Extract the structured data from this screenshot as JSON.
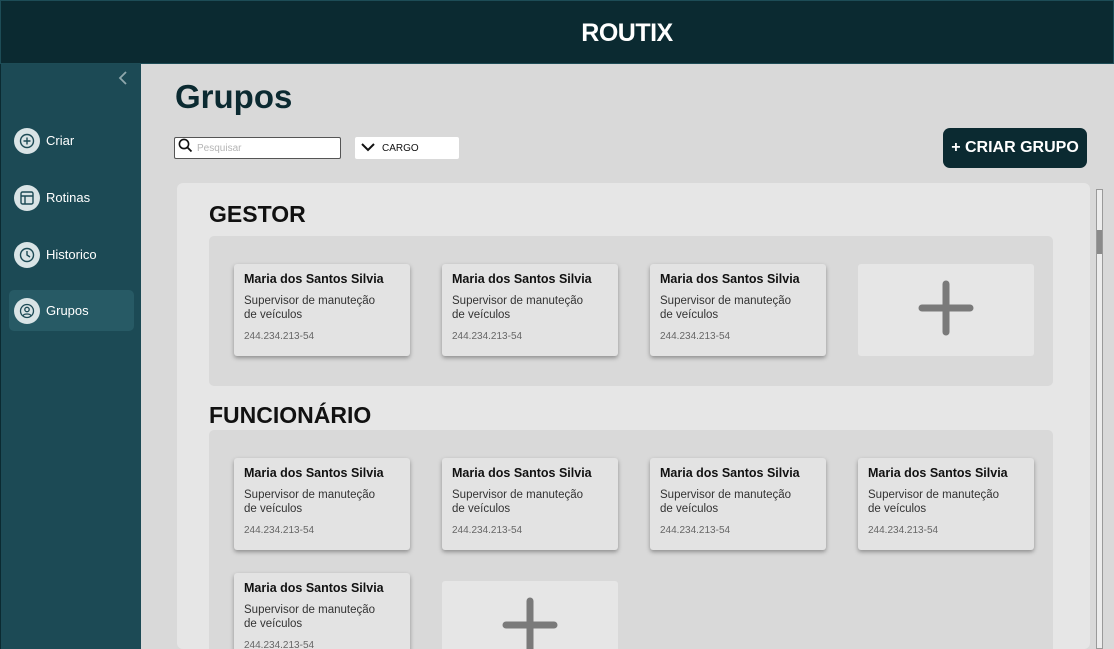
{
  "app": {
    "brand": "ROUTIX"
  },
  "sidebar": {
    "collapse_icon": "chevron-left-icon",
    "items": [
      {
        "label": "Criar",
        "icon": "plus-circle-icon",
        "active": false
      },
      {
        "label": "Rotinas",
        "icon": "table-icon",
        "active": false
      },
      {
        "label": "Historico",
        "icon": "clock-icon",
        "active": false
      },
      {
        "label": "Grupos",
        "icon": "user-icon",
        "active": true
      }
    ]
  },
  "page": {
    "title": "Grupos"
  },
  "toolbar": {
    "search_placeholder": "Pesquisar",
    "search_value": "",
    "cargo_label": "CARGO",
    "create_button": "+ CRIAR GRUPO"
  },
  "sections": [
    {
      "title": "GESTOR",
      "cards": [
        {
          "name": "Maria dos Santos Silvia",
          "role": "Supervisor de manuteção de veículos",
          "doc": "244.234.213-54"
        },
        {
          "name": "Maria dos Santos Silvia",
          "role": "Supervisor de manuteção de veículos",
          "doc": "244.234.213-54"
        },
        {
          "name": "Maria dos Santos Silvia",
          "role": "Supervisor de manuteção de veículos",
          "doc": "244.234.213-54"
        }
      ]
    },
    {
      "title": "FUNCIONÁRIO",
      "cards": [
        {
          "name": "Maria dos Santos Silvia",
          "role": "Supervisor de manuteção de veículos",
          "doc": "244.234.213-54"
        },
        {
          "name": "Maria dos Santos Silvia",
          "role": "Supervisor de manuteção de veículos",
          "doc": "244.234.213-54"
        },
        {
          "name": "Maria dos Santos Silvia",
          "role": "Supervisor de manuteção de veículos",
          "doc": "244.234.213-54"
        },
        {
          "name": "Maria dos Santos Silvia",
          "role": "Supervisor de manuteção de veículos",
          "doc": "244.234.213-54"
        },
        {
          "name": "Maria dos Santos Silvia",
          "role": "Supervisor de manuteção de veículos",
          "doc": "244.234.213-54"
        }
      ]
    }
  ],
  "colors": {
    "primary": "#0b2a31",
    "sidebar": "#1c4a55",
    "sidebar_active": "#275a65",
    "background": "#d9d9d9"
  }
}
